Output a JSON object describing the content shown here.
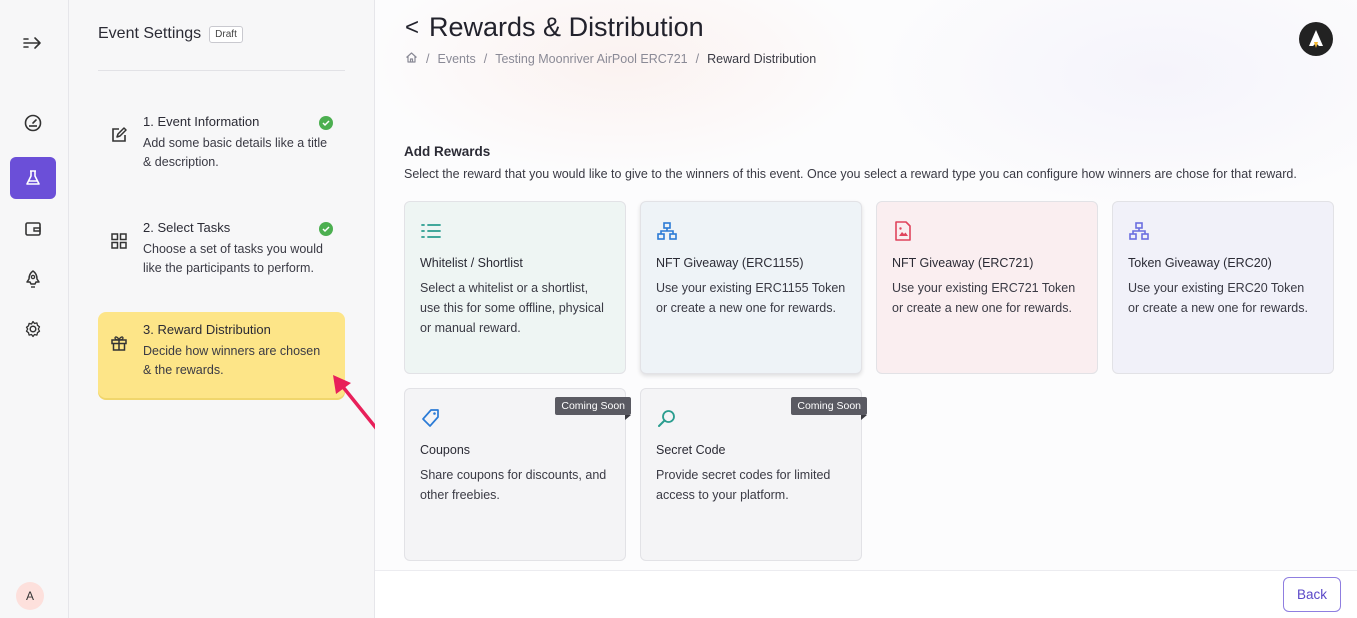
{
  "rail": {
    "items": [
      {
        "name": "collapse-arrow-icon"
      },
      {
        "name": "dashboard-gauge-icon"
      },
      {
        "name": "flask-icon"
      },
      {
        "name": "wallet-icon"
      },
      {
        "name": "rocket-icon"
      },
      {
        "name": "gear-icon"
      }
    ],
    "avatar_initial": "A"
  },
  "steps_panel": {
    "title": "Event Settings",
    "badge": "Draft",
    "steps": [
      {
        "title": "1. Event Information",
        "description": "Add some basic details like a title & description.",
        "icon": "edit-icon",
        "completed": true
      },
      {
        "title": "2. Select Tasks",
        "description": "Choose a set of tasks you would like the participants to perform.",
        "icon": "grid-icon",
        "completed": true
      },
      {
        "title": "3. Reward Distribution",
        "description": "Decide how winners are chosen & the rewards.",
        "icon": "gift-icon",
        "completed": false
      }
    ]
  },
  "header": {
    "back_symbol": "<",
    "title": "Rewards & Distribution",
    "breadcrumb": [
      "Events",
      "Testing Moonriver AirPool ERC721",
      "Reward Distribution"
    ],
    "breadcrumb_separator": "/"
  },
  "rewards": {
    "title": "Add Rewards",
    "description": "Select the reward that you would like to give to the winners of this event. Once you select a reward type you can configure how winners are chose for that reward.",
    "cards": [
      {
        "title": "Whitelist / Shortlist",
        "description": "Select a whitelist or a shortlist, use this for some offline, physical or manual reward.",
        "icon": "list-icon",
        "color": "#2a9d8f",
        "background": "#eef5f3",
        "badge": ""
      },
      {
        "title": "NFT Giveaway (ERC1155)",
        "description": "Use your existing ERC1155 Token or create a new one for rewards.",
        "icon": "hierarchy-icon",
        "color": "#2b7bd6",
        "background": "#eef3f7",
        "badge": ""
      },
      {
        "title": "NFT Giveaway (ERC721)",
        "description": "Use your existing ERC721 Token or create a new one for rewards.",
        "icon": "image-file-icon",
        "color": "#e0445c",
        "background": "#faeef0",
        "badge": ""
      },
      {
        "title": "Token Giveaway (ERC20)",
        "description": "Use your existing ERC20 Token or create a new one for rewards.",
        "icon": "hierarchy-icon",
        "color": "#6b6fe0",
        "background": "#f1f1f9",
        "badge": ""
      },
      {
        "title": "Coupons",
        "description": "Share coupons for discounts, and other freebies.",
        "icon": "tag-icon",
        "color": "#2b7bd6",
        "background": "#f4f4f6",
        "badge": "Coming Soon"
      },
      {
        "title": "Secret Code",
        "description": "Provide secret codes for limited access to your platform.",
        "icon": "search-icon",
        "color": "#2a9d8f",
        "background": "#f4f4f6",
        "badge": "Coming Soon"
      }
    ]
  },
  "footer": {
    "back_label": "Back"
  },
  "colors": {
    "accent": "#6b4fd8",
    "active_step": "#fde588",
    "annotation_arrow": "#e8205a"
  }
}
